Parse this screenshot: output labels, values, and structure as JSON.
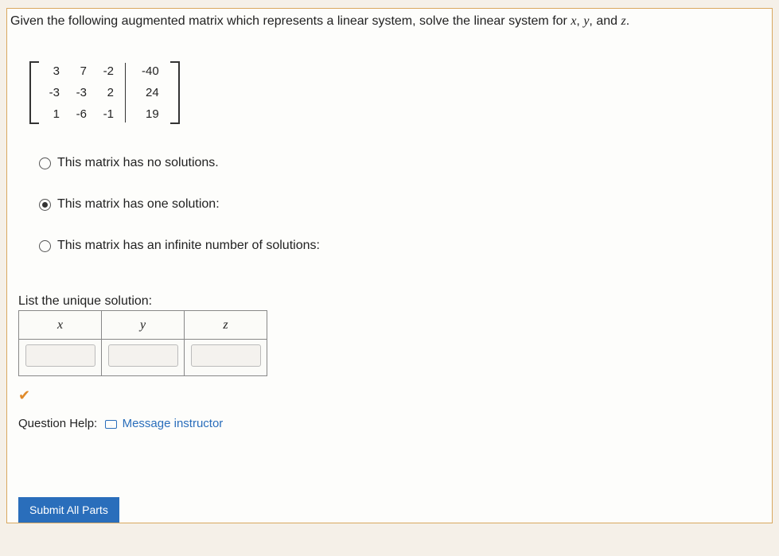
{
  "prompt": {
    "pre": "Given the following augmented matrix which represents a linear system, solve the linear system for ",
    "var1": "x",
    "mid1": ", ",
    "var2": "y",
    "mid2": ", and ",
    "var3": "z",
    "post": "."
  },
  "matrix": {
    "coef": [
      [
        "3",
        "7",
        "-2"
      ],
      [
        "-3",
        "-3",
        "2"
      ],
      [
        "1",
        "-6",
        "-1"
      ]
    ],
    "aug": [
      "-40",
      "24",
      "19"
    ]
  },
  "options": {
    "none": "This matrix has no solutions.",
    "one": "This matrix has one solution:",
    "inf": "This matrix has an infinite number of solutions:",
    "selected": "one"
  },
  "solution": {
    "label": "List the unique solution:",
    "headers": [
      "x",
      "y",
      "z"
    ],
    "values": [
      "",
      "",
      ""
    ]
  },
  "help": {
    "label": "Question Help:",
    "link": "Message instructor"
  },
  "submit_label": "Submit All Parts"
}
